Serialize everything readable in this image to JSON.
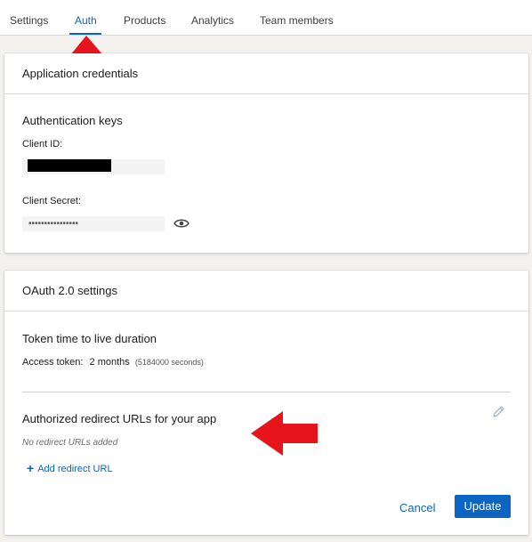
{
  "tabs": [
    {
      "label": "Settings",
      "active": false
    },
    {
      "label": "Auth",
      "active": true
    },
    {
      "label": "Products",
      "active": false
    },
    {
      "label": "Analytics",
      "active": false
    },
    {
      "label": "Team members",
      "active": false
    }
  ],
  "credentials": {
    "title": "Application credentials",
    "section_title": "Authentication keys",
    "client_id_label": "Client ID:",
    "client_secret_label": "Client Secret:",
    "client_secret_masked": "••••••••••••••••"
  },
  "oauth": {
    "title": "OAuth 2.0 settings",
    "token_section_title": "Token time to live duration",
    "access_token_label": "Access token:",
    "access_token_value": "2 months",
    "access_token_seconds": "(5184000 seconds)",
    "redirect_section_title": "Authorized redirect URLs for your app",
    "no_redirect_text": "No redirect URLs added",
    "add_redirect_label": "Add redirect URL",
    "cancel_label": "Cancel",
    "update_label": "Update"
  },
  "colors": {
    "accent": "#0a66c2",
    "annotation_arrow": "#e8141c"
  },
  "icons": {
    "reveal": "eye-icon",
    "edit": "pencil-icon",
    "add": "plus-icon"
  }
}
